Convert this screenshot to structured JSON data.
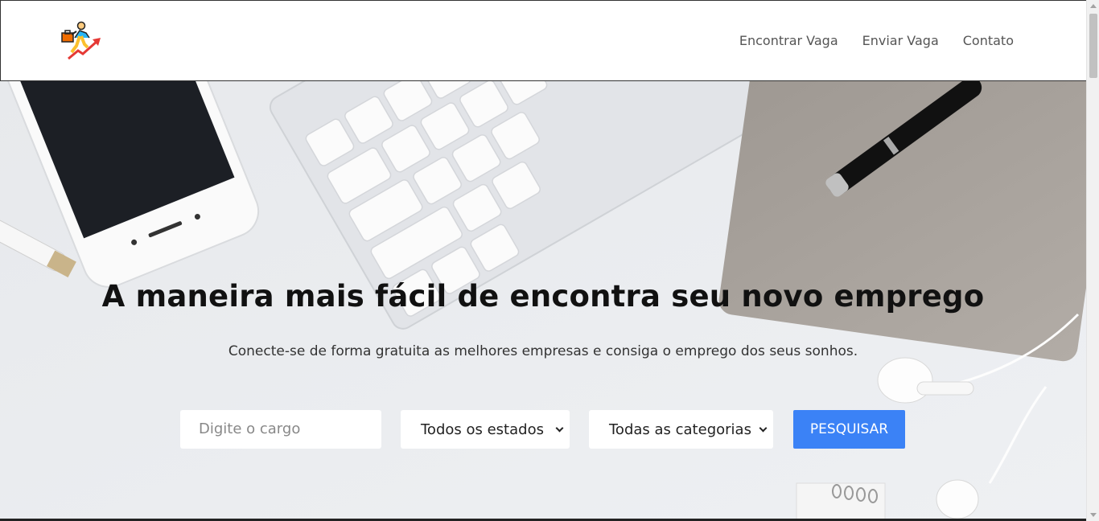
{
  "header": {
    "logo_icon": "career-growth-logo-icon",
    "nav": [
      {
        "label": "Encontrar Vaga"
      },
      {
        "label": "Enviar Vaga"
      },
      {
        "label": "Contato"
      }
    ]
  },
  "hero": {
    "title": "A maneira mais fácil de encontra seu novo emprego",
    "subtitle": "Conecte-se de forma gratuita as melhores empresas e consiga o emprego dos seus sonhos."
  },
  "search": {
    "cargo_placeholder": "Digite o cargo",
    "estados_selected": "Todos os estados",
    "categorias_selected": "Todas as categorias",
    "button_label": "PESQUISAR"
  },
  "colors": {
    "accent": "#3b82f6",
    "hero_background": "#e9ebee"
  }
}
